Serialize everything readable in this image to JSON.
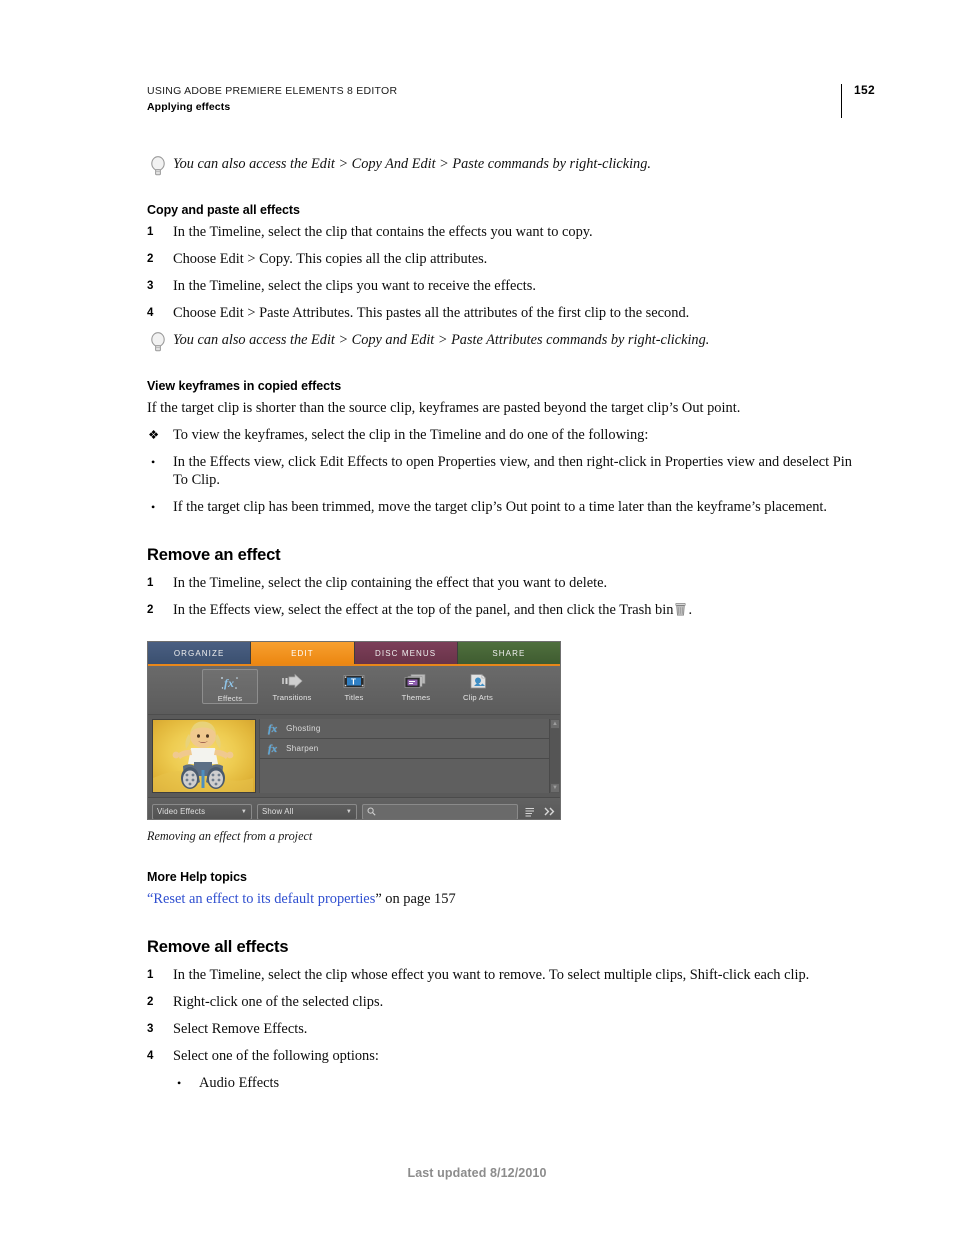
{
  "header": {
    "title": "USING ADOBE PREMIERE ELEMENTS 8 EDITOR",
    "subtitle": "Applying effects",
    "page_number": "152"
  },
  "tip_top": {
    "icon": "lightbulb-icon",
    "text": "You can also access the Edit > Copy And Edit > Paste commands by right-clicking."
  },
  "section_copy_paste": {
    "heading": "Copy and paste all effects",
    "steps": [
      {
        "num": "1",
        "text": "In the Timeline, select the clip that contains the effects you want to copy."
      },
      {
        "num": "2",
        "text": "Choose Edit > Copy. This copies all the clip attributes."
      },
      {
        "num": "3",
        "text": "In the Timeline, select the clips you want to receive the effects."
      },
      {
        "num": "4",
        "text": "Choose Edit > Paste Attributes. This pastes all the attributes of the first clip to the second."
      }
    ],
    "tip": "You can also access the Edit > Copy and Edit > Paste Attributes commands by right-clicking."
  },
  "section_view_keyframes": {
    "heading": "View keyframes in copied effects",
    "intro": "If the target clip is shorter than the source clip, keyframes are pasted beyond the target clip’s Out point.",
    "action": {
      "mark": "❖",
      "text": "To view the keyframes, select the clip in the Timeline and do one of the following:"
    },
    "bullets": [
      {
        "mark": "•",
        "text": "In the Effects view, click Edit Effects to open Properties view, and then right-click in Properties view and deselect Pin To Clip."
      },
      {
        "mark": "•",
        "text": "If the target clip has been trimmed, move the target clip’s Out point to a time later than the keyframe’s placement."
      }
    ]
  },
  "section_remove_effect": {
    "heading": "Remove an effect",
    "steps": [
      {
        "num": "1",
        "text": "In the Timeline, select the clip containing the effect that you want to delete."
      }
    ],
    "step2": {
      "num": "2",
      "text_before": "In the Effects view, select the effect at the top of the panel, and then click the Trash bin",
      "icon": "trash-bin-icon",
      "text_after": "."
    },
    "caption": "Removing an effect from a project"
  },
  "app_screenshot": {
    "tabs": [
      {
        "label": "ORGANIZE",
        "color": "#3b5070",
        "selected": false
      },
      {
        "label": "EDIT",
        "color": "#ec8711",
        "selected": true
      },
      {
        "label": "DISC MENUS",
        "color": "#693349",
        "selected": false
      },
      {
        "label": "SHARE",
        "color": "#3f5c30",
        "selected": false
      }
    ],
    "toolbar": [
      {
        "label": "Effects",
        "icon": "fx-icon",
        "selected": true
      },
      {
        "label": "Transitions",
        "icon": "arrow-transition-icon",
        "selected": false
      },
      {
        "label": "Titles",
        "icon": "title-filmstrip-icon",
        "selected": false
      },
      {
        "label": "Themes",
        "icon": "themes-icon",
        "selected": false
      },
      {
        "label": "Clip Arts",
        "icon": "clip-art-icon",
        "selected": false
      }
    ],
    "thumbnail": {
      "name": "clip-thumbnail",
      "description": "child-on-yellow-background"
    },
    "effects": [
      {
        "icon": "fx-icon",
        "name": "Ghosting"
      },
      {
        "icon": "fx-icon",
        "name": "Sharpen"
      }
    ],
    "bottom_bar": {
      "category_dropdown": "Video Effects",
      "filter_dropdown": "Show All",
      "search_placeholder": "",
      "search_icon": "search-icon",
      "list_view_icon": "list-view-icon",
      "expand_icon": "double-chevron-right-icon"
    }
  },
  "section_more_help": {
    "heading": "More Help topics",
    "link_open_quote": "“",
    "link_text": "Reset an effect to its default properties",
    "link_close_quote": "”",
    "link_suffix": " on page 157",
    "link_color": "#2f4fd0"
  },
  "section_remove_all": {
    "heading": "Remove all effects",
    "steps": [
      {
        "num": "1",
        "text": "In the Timeline, select the clip whose effect you want to remove. To select multiple clips, Shift-click each clip."
      },
      {
        "num": "2",
        "text": "Right-click one of the selected clips."
      },
      {
        "num": "3",
        "text": "Select Remove Effects."
      },
      {
        "num": "4",
        "text": "Select one of the following options:"
      }
    ],
    "sub_bullets": [
      {
        "mark": "•",
        "text": "Audio Effects"
      }
    ]
  },
  "footer": {
    "text": "Last updated 8/12/2010"
  }
}
